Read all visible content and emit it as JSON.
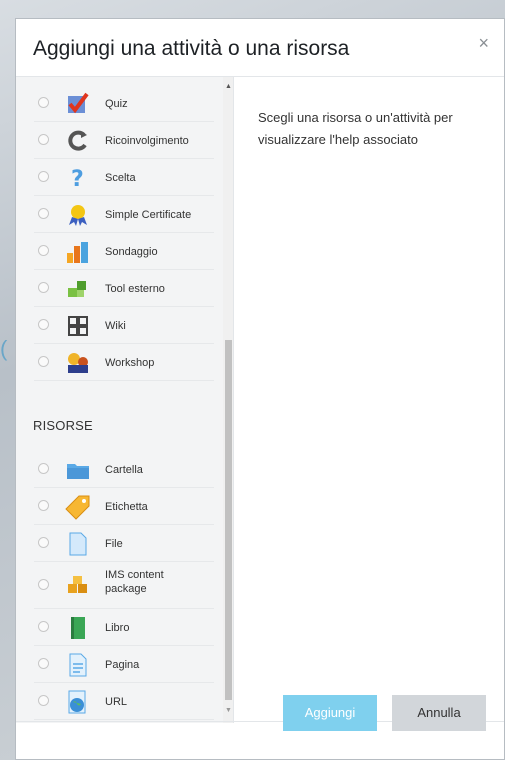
{
  "dialog": {
    "title": "Aggiungi una attività o una risorsa",
    "close_symbol": "×",
    "help_text": "Scegli una risorsa o un'attività per visualizzare l'help associato",
    "add_button": "Aggiungi",
    "cancel_button": "Annulla"
  },
  "activities": [
    {
      "label": "Quiz",
      "icon": "quiz-check-icon"
    },
    {
      "label": "Ricoinvolgimento",
      "icon": "reengagement-icon"
    },
    {
      "label": "Scelta",
      "icon": "question-mark-icon"
    },
    {
      "label": "Simple Certificate",
      "icon": "certificate-icon"
    },
    {
      "label": "Sondaggio",
      "icon": "bar-chart-icon"
    },
    {
      "label": "Tool esterno",
      "icon": "puzzle-icon"
    },
    {
      "label": "Wiki",
      "icon": "wiki-icon"
    },
    {
      "label": "Workshop",
      "icon": "workshop-icon"
    }
  ],
  "resources_heading": "RISORSE",
  "resources": [
    {
      "label": "Cartella",
      "icon": "folder-icon"
    },
    {
      "label": "Etichetta",
      "icon": "tag-icon"
    },
    {
      "label": "File",
      "icon": "file-icon"
    },
    {
      "label": "IMS content\npackage",
      "icon": "package-icon"
    },
    {
      "label": "Libro",
      "icon": "book-icon"
    },
    {
      "label": "Pagina",
      "icon": "page-icon"
    },
    {
      "label": "URL",
      "icon": "globe-icon"
    }
  ],
  "colors": {
    "accent": "#7fd0ee",
    "cancel": "#d2d6da"
  }
}
